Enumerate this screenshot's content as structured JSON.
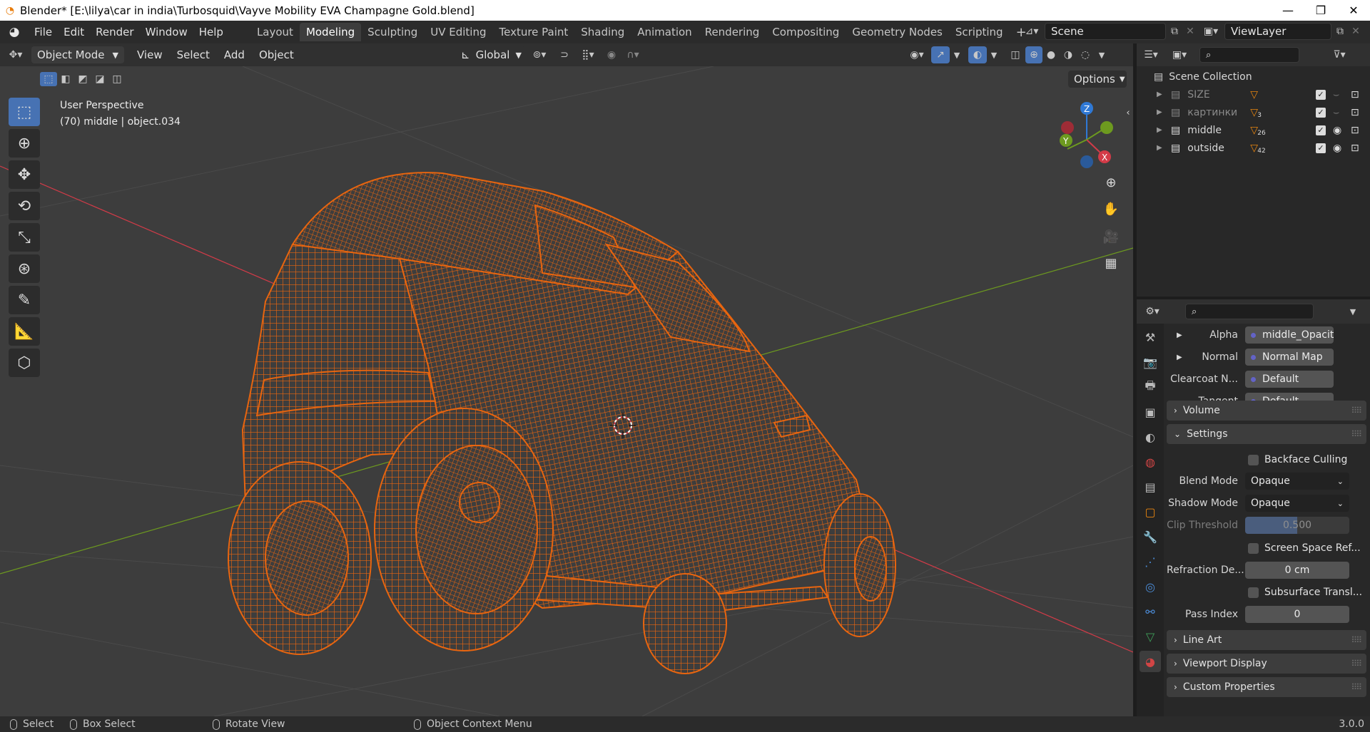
{
  "window": {
    "title": "Blender* [E:\\lilya\\car in india\\Turbosquid\\Vayve Mobility EVA Champagne Gold.blend]",
    "minimize": "—",
    "maximize": "❐",
    "close": "✕"
  },
  "menu": [
    "File",
    "Edit",
    "Render",
    "Window",
    "Help"
  ],
  "workspaces": [
    "Layout",
    "Modeling",
    "Sculpting",
    "UV Editing",
    "Texture Paint",
    "Shading",
    "Animation",
    "Rendering",
    "Compositing",
    "Geometry Nodes",
    "Scripting"
  ],
  "active_workspace": "Modeling",
  "add_workspace": "+",
  "scene": {
    "name": "Scene",
    "view_layer": "ViewLayer"
  },
  "viewport_header": {
    "mode": "Object Mode",
    "menus": [
      "View",
      "Select",
      "Add",
      "Object"
    ],
    "orientation": "Global",
    "options": "Options"
  },
  "viewport": {
    "perspective": "User Perspective",
    "object_info": "(70) middle | object.034",
    "gizmo": {
      "x": "X",
      "y": "Y",
      "z": "Z"
    }
  },
  "toolbar": {
    "tools": [
      "select-box-tool",
      "cursor-tool",
      "move-tool",
      "rotate-tool",
      "scale-tool",
      "transform-tool",
      "annotate-tool",
      "measure-tool",
      "add-cube-tool"
    ],
    "active": "select-box-tool"
  },
  "outliner": {
    "root": "Scene Collection",
    "items": [
      {
        "name": "SIZE",
        "badge": "",
        "dim": true
      },
      {
        "name": "картинки",
        "badge": "3",
        "dim": true
      },
      {
        "name": "middle",
        "badge": "26",
        "dim": false
      },
      {
        "name": "outside",
        "badge": "42",
        "dim": false
      }
    ]
  },
  "properties": {
    "sockets": [
      {
        "label": "Alpha",
        "value": "middle_Opacity..."
      },
      {
        "label": "Normal",
        "value": "Normal Map"
      },
      {
        "label": "Clearcoat N...",
        "value": "Default"
      },
      {
        "label": "Tangent",
        "value": "Default"
      }
    ],
    "panels": {
      "volume": "Volume",
      "settings": "Settings",
      "line_art": "Line Art",
      "viewport_display": "Viewport Display",
      "custom_properties": "Custom Properties"
    },
    "settings": {
      "backface_culling": "Backface Culling",
      "blend_mode_label": "Blend Mode",
      "blend_mode": "Opaque",
      "shadow_mode_label": "Shadow Mode",
      "shadow_mode": "Opaque",
      "clip_threshold_label": "Clip Threshold",
      "clip_threshold": "0.500",
      "screen_space_refraction": "Screen Space Ref...",
      "refraction_depth_label": "Refraction De...",
      "refraction_depth": "0 cm",
      "subsurface_translucency": "Subsurface Transl...",
      "pass_index_label": "Pass Index",
      "pass_index": "0"
    }
  },
  "statusbar": {
    "select": "Select",
    "box_select": "Box Select",
    "rotate_view": "Rotate View",
    "context_menu": "Object Context Menu",
    "version": "3.0.0"
  },
  "colors": {
    "accent": "#4772b3",
    "wireframe": "#e8650f",
    "viewport_bg": "#3d3d3d",
    "axis_x": "#d33b48",
    "axis_y": "#6d9a1f",
    "axis_z": "#2f79d6"
  }
}
